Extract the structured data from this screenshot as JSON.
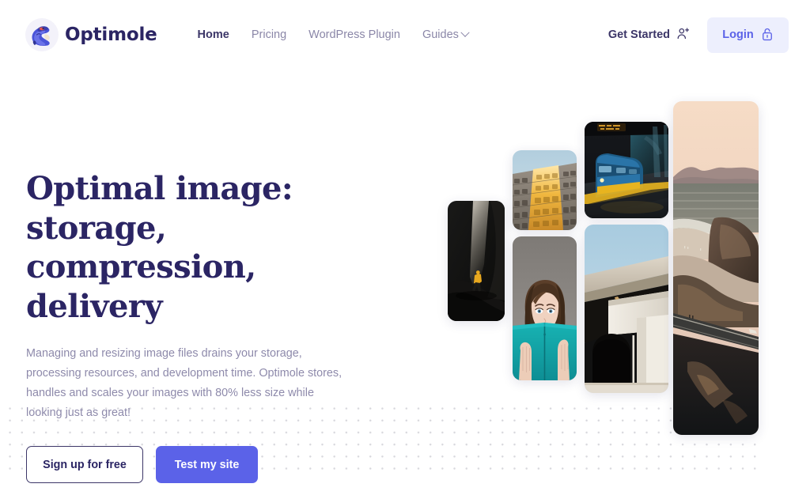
{
  "brand": {
    "name": "Optimole",
    "logo_icon": "mole-mascot-icon",
    "text_color": "#2b2564"
  },
  "header": {
    "nav": [
      {
        "label": "Home",
        "active": true
      },
      {
        "label": "Pricing",
        "active": false
      },
      {
        "label": "WordPress Plugin",
        "active": false
      },
      {
        "label": "Guides",
        "active": false,
        "icon": "chevron-down-icon"
      }
    ],
    "get_started": {
      "label": "Get Started",
      "icon": "user-plus-icon"
    },
    "login": {
      "label": "Login",
      "icon": "lock-open-icon",
      "background": "#edeffd",
      "text_color": "#5b62e8"
    }
  },
  "hero": {
    "title": "Optimal image: storage, compression, delivery",
    "subtitle": "Managing and resizing image files drains your storage, processing resources, and development time. Optimole stores, handles and scales your images with 80% less size while looking just as great!",
    "primary_button": {
      "label": "Test my site",
      "background": "#5b62e8",
      "text_color": "#ffffff"
    },
    "secondary_button": {
      "label": "Sign up for free",
      "background": "#ffffff",
      "text_color": "#2b2564"
    }
  },
  "collage": {
    "photos": [
      {
        "id": "photo-cave",
        "alt": "Person in yellow jacket walking inside a dark cave"
      },
      {
        "id": "photo-building",
        "alt": "Low angle of apartment building facade lit golden by sun"
      },
      {
        "id": "photo-train",
        "alt": "Blue and yellow train at a station platform at night"
      },
      {
        "id": "photo-reader",
        "alt": "Woman holding a teal book covering her face"
      },
      {
        "id": "photo-bridge",
        "alt": "Concrete overpass bridge against blue sky"
      },
      {
        "id": "photo-coast",
        "alt": "Aerial coastline at sunset with ocean, cliffs and road"
      }
    ]
  },
  "decor": {
    "dot_grid_color": "#d9d9de"
  }
}
